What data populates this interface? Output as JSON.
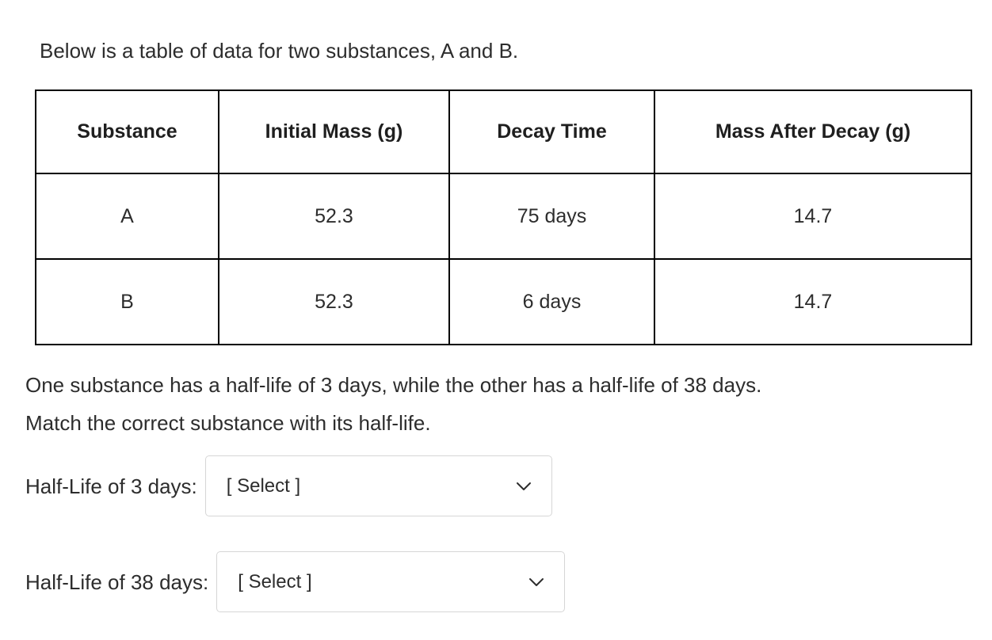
{
  "intro": {
    "text": "Below is a table of data for two substances, A and B."
  },
  "table": {
    "headers": [
      "Substance",
      "Initial Mass (g)",
      "Decay Time",
      "Mass After Decay (g)"
    ],
    "rows": [
      [
        "A",
        "52.3",
        "75 days",
        "14.7"
      ],
      [
        "B",
        "52.3",
        "6 days",
        "14.7"
      ]
    ]
  },
  "prompt": {
    "line1": "One substance has a half-life of 3 days, while the other has a half-life of 38 days.",
    "line2": "Match the correct substance with its half-life."
  },
  "matches": [
    {
      "label": "Half-Life of 3 days:",
      "select_value": "[ Select ]",
      "chevron_icon": "chevron-down-icon"
    },
    {
      "label": "Half-Life of 38 days:",
      "select_value": "[ Select ]",
      "chevron_icon": "chevron-down-icon"
    }
  ],
  "colors": {
    "text": "#2d2d2d",
    "table_border": "#000000",
    "select_border": "#d6d6d6",
    "background": "#ffffff"
  }
}
